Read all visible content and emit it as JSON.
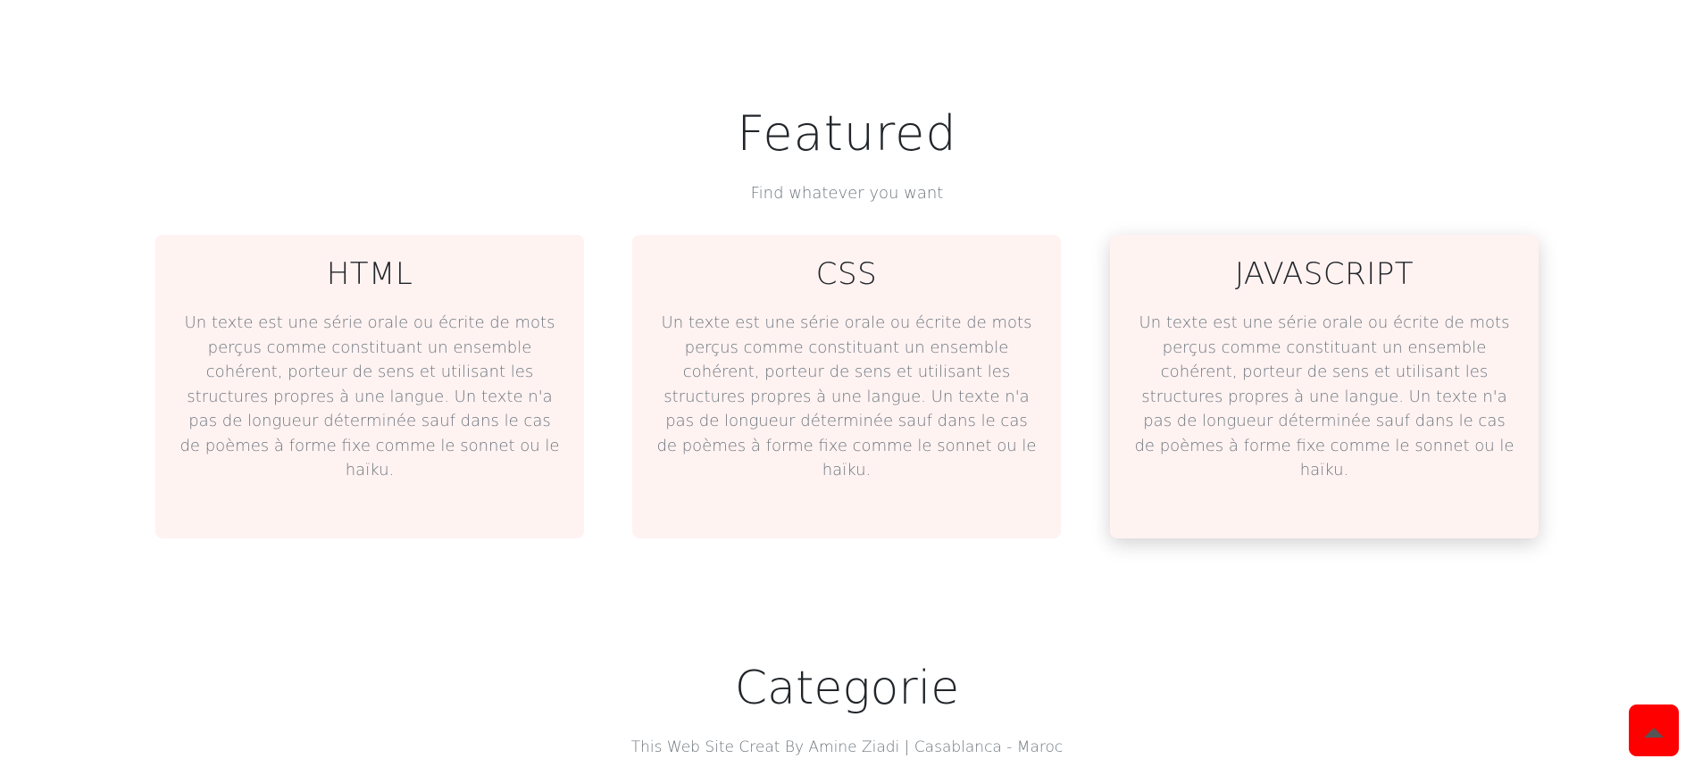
{
  "featured": {
    "title": "Featured",
    "subtitle": "Find whatever you want"
  },
  "cards": [
    {
      "title": "HTML",
      "text": "Un texte est une série orale ou écrite de mots perçus comme constituant un ensemble cohérent, porteur de sens et utilisant les structures propres à une langue. Un texte n'a pas de longueur déterminée sauf dans le cas de poèmes à forme fixe comme le sonnet ou le haïku."
    },
    {
      "title": "CSS",
      "text": "Un texte est une série orale ou écrite de mots perçus comme constituant un ensemble cohérent, porteur de sens et utilisant les structures propres à une langue. Un texte n'a pas de longueur déterminée sauf dans le cas de poèmes à forme fixe comme le sonnet ou le haïku."
    },
    {
      "title": "JAVASCRIPT",
      "text": "Un texte est une série orale ou écrite de mots perçus comme constituant un ensemble cohérent, porteur de sens et utilisant les structures propres à une langue. Un texte n'a pas de longueur déterminée sauf dans le cas de poèmes à forme fixe comme le sonnet ou le haïku."
    }
  ],
  "categorie": {
    "title": "Categorie"
  },
  "footer": {
    "text": "This Web Site Creat By Amine Ziadi | Casablanca - Maroc"
  },
  "scroll_top": {
    "icon": "arrow-up-icon",
    "color": "#ff0000"
  }
}
